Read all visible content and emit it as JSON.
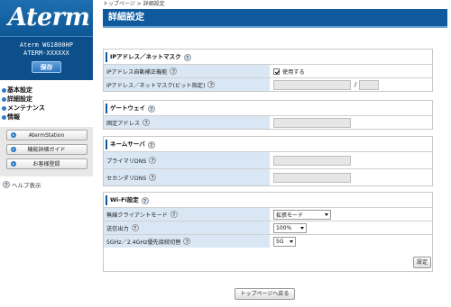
{
  "sidebar": {
    "logo": "Aterm",
    "model": "Aterm WG1800HP",
    "device_id": "ATERM-XXXXXX",
    "save_label": "保存",
    "menu": [
      "基本設定",
      "詳細設定",
      "メンテナンス",
      "情報"
    ],
    "sub_buttons": [
      "AtermStation",
      "機能詳細ガイド",
      "お客様登録"
    ],
    "help_label": "ヘルプ表示"
  },
  "breadcrumb": {
    "home": "トップページ",
    "sep": " > ",
    "current": "詳細設定"
  },
  "page_title": "詳細設定",
  "sections": {
    "ip": {
      "title": "IPアドレス／ネットマスク",
      "auto_label": "IPアドレス自動補正機能",
      "auto_value": "使用する",
      "auto_checked": true,
      "manual_label": "IPアドレス／ネットマスク(ビット指定)",
      "slash": "/"
    },
    "gateway": {
      "title": "ゲートウェイ",
      "fixed_label": "固定アドレス"
    },
    "dns": {
      "title": "ネームサーバ",
      "primary_label": "プライマリDNS",
      "secondary_label": "セカンダリDNS"
    },
    "wifi": {
      "title": "Wi-Fi設定",
      "client_mode_label": "無線クライアントモード",
      "client_mode_value": "拡張モード",
      "tx_power_label": "送信出力",
      "tx_power_value": "100%",
      "band_label": "5GHz／2.4GHz優先接続切替",
      "band_value": "5G"
    }
  },
  "buttons": {
    "apply": "設定",
    "back_top": "トップページへ戻る"
  },
  "help_glyph": "?",
  "colors": {
    "brand_blue": "#0f5a9c",
    "label_bg": "#d9e7f5"
  }
}
